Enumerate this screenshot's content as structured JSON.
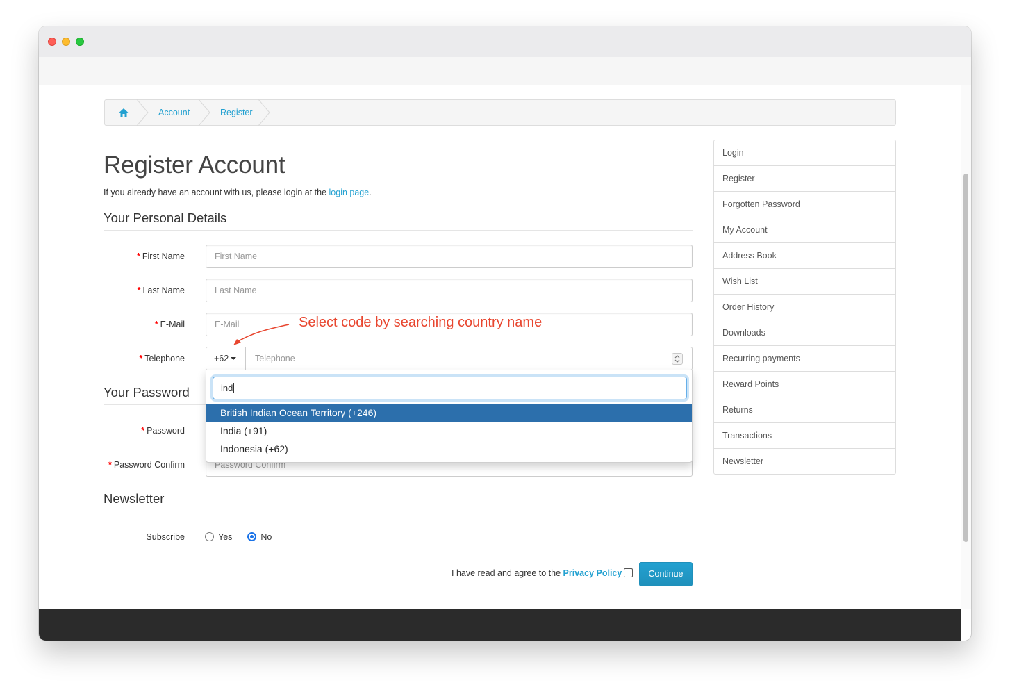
{
  "breadcrumb": {
    "home_icon": "home-icon",
    "items": [
      "Account",
      "Register"
    ]
  },
  "page": {
    "title": "Register Account",
    "intro_text": "If you already have an account with us, please login at the ",
    "intro_link": "login page",
    "intro_end": "."
  },
  "personal": {
    "heading": "Your Personal Details",
    "first_name_label": "First Name",
    "first_name_placeholder": "First Name",
    "last_name_label": "Last Name",
    "last_name_placeholder": "Last Name",
    "email_label": "E-Mail",
    "email_placeholder": "E-Mail",
    "telephone_label": "Telephone",
    "telephone_code": "+62",
    "telephone_placeholder": "Telephone"
  },
  "annotation": {
    "text": "Select code by searching country name",
    "color": "#e8462f"
  },
  "country_dropdown": {
    "search_value": "ind",
    "options": [
      "British Indian Ocean Territory (+246)",
      "India (+91)",
      "Indonesia (+62)"
    ],
    "active_index": 0
  },
  "password": {
    "heading": "Your Password",
    "password_label": "Password",
    "confirm_label": "Password Confirm",
    "confirm_placeholder": "Password Confirm"
  },
  "newsletter": {
    "heading": "Newsletter",
    "subscribe_label": "Subscribe",
    "yes_label": "Yes",
    "no_label": "No",
    "selected": "No"
  },
  "agreement": {
    "text": "I have read and agree to the ",
    "link": "Privacy Policy",
    "checked": false
  },
  "continue_label": "Continue",
  "sidebar": {
    "items": [
      "Login",
      "Register",
      "Forgotten Password",
      "My Account",
      "Address Book",
      "Wish List",
      "Order History",
      "Downloads",
      "Recurring payments",
      "Reward Points",
      "Returns",
      "Transactions",
      "Newsletter"
    ]
  },
  "colors": {
    "link": "#23a1d1",
    "required": "#ff0000",
    "active_option": "#2c6fac",
    "footer": "#2b2b2b"
  }
}
